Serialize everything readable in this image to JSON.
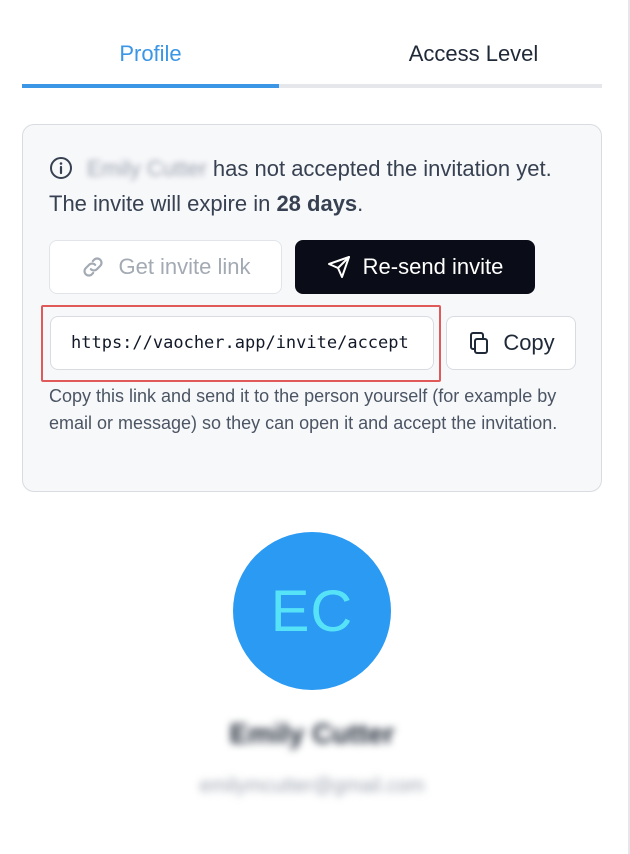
{
  "tabs": [
    {
      "label": "Profile",
      "active": true
    },
    {
      "label": "Access Level",
      "active": false
    }
  ],
  "notice": {
    "icon": "info-icon",
    "name": "Emily Cutter",
    "text_before_days": "has not accepted the invitation yet. The invite will expire in",
    "days": "28 days",
    "text_after_days": "."
  },
  "buttons": {
    "get_link": {
      "label": "Get invite link",
      "icon": "link-icon",
      "enabled": false
    },
    "resend": {
      "label": "Re-send invite",
      "icon": "send-icon"
    },
    "copy": {
      "label": "Copy",
      "icon": "copy-icon"
    }
  },
  "invite_link": {
    "value": "https://vaocher.app/invite/accept"
  },
  "helper_text": "Copy this link and send it to the person yourself (for example by email or message) so they can open it and accept the invitation.",
  "profile": {
    "initials": "EC",
    "name": "Emily Cutter",
    "email": "emilymcutter@gmail.com"
  },
  "colors": {
    "accent": "#3b96e6",
    "avatar_bg": "#2b9af3",
    "avatar_text": "#57e3f7",
    "primary_button": "#0a0d17",
    "highlight_border": "#e05a5a"
  }
}
